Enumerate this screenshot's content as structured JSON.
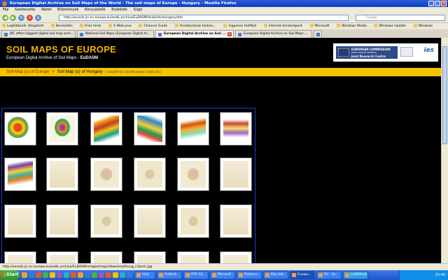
{
  "window": {
    "title": "European Digital Archive on Soil Maps of the World - The soil maps of Europe - Hungary - Mozilla Firefox"
  },
  "menu": [
    "Fájl",
    "Szerkesztés",
    "Nézet",
    "Előzmények",
    "Könyvjelzők",
    "Eszközök",
    "Súgó"
  ],
  "nav": {
    "url": "http://eusoils.jrc.ec.europa.eu/esdb_archive/EuDASM/Asia/lists/hungary.htm",
    "search_placeholder": "Google"
  },
  "bookmarks": [
    "Legtöbbször látogatott",
    "Bevezetés",
    "Friss hírek",
    "A Web java",
    "Channel Guide",
    "Hivatkozások testres...",
    "Ingyenes HotMail",
    "Internet kiindulópont",
    "Microsoft",
    "Windows Media",
    "Windows Update",
    "Windows"
  ],
  "tabs": [
    {
      "label": "JRC offers biggest digital soil map arch..."
    },
    {
      "label": "National Soil Maps (European Digital Ar..."
    },
    {
      "label": "European Digital Archive on Soil ..."
    },
    {
      "label": "European Digital Archive on Soil Maps ..."
    }
  ],
  "site": {
    "title": "SOIL MAPS OF EUROPE",
    "subtitle_prefix": "European Digital Archive of Soil Maps - ",
    "subtitle_bold": "EuDASM",
    "logo_ec_line1": "EUROPEAN COMMISSION",
    "logo_ec_line2": "DIRECTORATE-GENERAL",
    "logo_ec_line3": "Joint Research Centre",
    "logo_ies": "ies",
    "breadcrumb_root": "Soil Map (s) of Europe",
    "breadcrumb_sep": ">",
    "breadcrumb_current": "Soil Map (s) of Hungary",
    "breadcrumb_note": "( Compiled by: Dorottó Kanyar Zsánóciné )"
  },
  "status_text": "http://eusoils.jrc.ec.europa.eu/esdb_archive/EuDASM/images/maps/download/hung_c1back.jpg",
  "taskbar": {
    "start": "Start",
    "items": [
      "taláj",
      "Outlook...",
      "MTA SZ...",
      "Microsof...",
      "Dokume...",
      "Kép bek...",
      "Europe...",
      "EU - So..."
    ],
    "tray_label": "Letöltések",
    "clock": "23:48"
  }
}
